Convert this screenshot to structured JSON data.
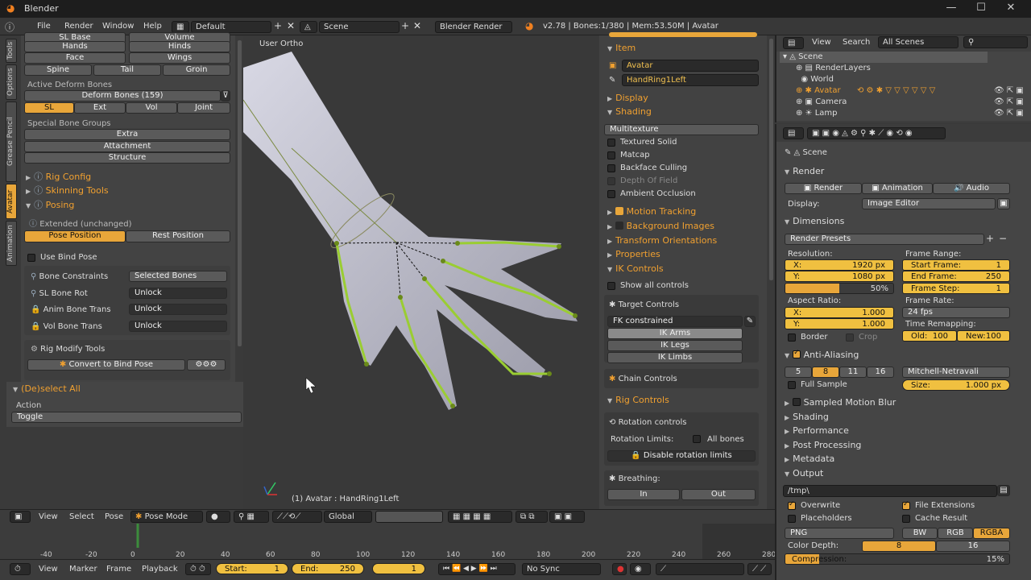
{
  "window": {
    "title": "Blender",
    "controls": [
      "—",
      "☐",
      "✕"
    ]
  },
  "menubar": {
    "items": [
      "File",
      "Render",
      "Window",
      "Help"
    ],
    "layout": "Default",
    "scene": "Scene",
    "engine": "Blender Render",
    "stats": "v2.78 | Bones:1/380 | Mem:53.50M | Avatar"
  },
  "tools_tabs": [
    "Tools",
    "Options",
    "Grease Pencil",
    "Avatar",
    "Animation"
  ],
  "left": {
    "bone_groups_top": [
      "SL Base",
      "Volume",
      "Hands",
      "Hinds",
      "Face",
      "Wings"
    ],
    "bone_groups_row3": [
      "Spine",
      "Tail",
      "Groin"
    ],
    "active_deform_label": "Active Deform Bones",
    "deform_bones": "Deform Bones (159)",
    "deform_tabs": [
      "SL",
      "Ext",
      "Vol",
      "Joint"
    ],
    "special_groups_label": "Special Bone Groups",
    "special_groups": [
      "Extra",
      "Attachment",
      "Structure"
    ],
    "rig_config": "Rig Config",
    "skinning_tools": "Skinning Tools",
    "posing": "Posing",
    "extended": "Extended (unchanged)",
    "pose_position": "Pose Position",
    "rest_position": "Rest Position",
    "use_bind_pose": "Use Bind Pose",
    "bone_constraints_label": "Bone Constraints",
    "bone_constraints_value": "Selected Bones",
    "sl_bone_rot": "SL Bone Rot",
    "anim_bone_trans": "Anim Bone Trans",
    "vol_bone_trans": "Vol Bone Trans",
    "unlock": "Unlock",
    "rig_modify_tools": "Rig Modify Tools",
    "convert_bind_pose": "Convert to Bind Pose",
    "operator_title": "(De)select All",
    "action_label": "Action",
    "action_value": "Toggle"
  },
  "viewport": {
    "view_label": "User Ortho",
    "status": "(1) Avatar : HandRing1Left"
  },
  "nprops": {
    "item_header": "Item",
    "object_name": "Avatar",
    "bone_name": "HandRing1Left",
    "display": "Display",
    "shading": "Shading",
    "shading_mode": "Multitexture",
    "textured_solid": "Textured Solid",
    "matcap": "Matcap",
    "backface_culling": "Backface Culling",
    "depth_of_field": "Depth Of Field",
    "ambient_occlusion": "Ambient Occlusion",
    "motion_tracking": "Motion Tracking",
    "background_images": "Background Images",
    "transform_orientations": "Transform Orientations",
    "properties": "Properties",
    "ik_controls": "IK Controls",
    "show_all_controls": "Show all controls",
    "target_controls": "Target Controls",
    "fk_constrained": "FK constrained",
    "ik_list": [
      "IK Arms",
      "IK Legs",
      "IK Limbs"
    ],
    "chain_controls": "Chain Controls",
    "rig_controls": "Rig Controls",
    "rotation_controls": "Rotation controls",
    "rotation_limits": "Rotation Limits:",
    "all_bones": "All bones",
    "disable_rotation_limits": "Disable rotation limits",
    "breathing": "Breathing:",
    "in": "In",
    "out": "Out"
  },
  "view3d_header": {
    "items": [
      "View",
      "Select",
      "Pose"
    ],
    "mode": "Pose Mode",
    "orientation": "Global"
  },
  "timeline": {
    "ticks": [
      "-40",
      "-20",
      "0",
      "20",
      "40",
      "60",
      "80",
      "100",
      "120",
      "140",
      "160",
      "180",
      "200",
      "220",
      "240",
      "260",
      "280"
    ],
    "menu": [
      "View",
      "Marker",
      "Frame",
      "Playback"
    ],
    "start_label": "Start:",
    "start": "1",
    "end_label": "End:",
    "end": "250",
    "current": "1",
    "sync": "No Sync"
  },
  "outliner": {
    "menu": [
      "View",
      "Search"
    ],
    "filter": "All Scenes",
    "items": [
      "Scene",
      "RenderLayers",
      "World",
      "Avatar",
      "Camera",
      "Lamp"
    ]
  },
  "properties": {
    "breadcrumb": "Scene",
    "render_header": "Render",
    "render_btn": "Render",
    "animation_btn": "Animation",
    "audio_btn": "Audio",
    "display_label": "Display:",
    "display_value": "Image Editor",
    "dimensions": "Dimensions",
    "render_presets": "Render Presets",
    "resolution": "Resolution:",
    "res_x_label": "X:",
    "res_x": "1920 px",
    "res_y_label": "Y:",
    "res_y": "1080 px",
    "res_pct": "50%",
    "res_pct_value": 0.5,
    "frame_range": "Frame Range:",
    "start_frame_label": "Start Frame:",
    "start_frame": "1",
    "end_frame_label": "End Frame:",
    "end_frame": "250",
    "frame_step_label": "Frame Step:",
    "frame_step": "1",
    "aspect_ratio": "Aspect Ratio:",
    "asp_x": "1.000",
    "asp_y": "1.000",
    "frame_rate": "Frame Rate:",
    "fps": "24 fps",
    "border": "Border",
    "crop": "Crop",
    "time_remapping": "Time Remapping:",
    "old_label": "Old:",
    "old": "100",
    "new_label": "New:",
    "new": "100",
    "anti_aliasing": "Anti-Aliasing",
    "aa_samples": [
      "5",
      "8",
      "11",
      "16"
    ],
    "aa_filter": "Mitchell-Netravali",
    "full_sample": "Full Sample",
    "size_label": "Size:",
    "size": "1.000 px",
    "sampled_motion_blur": "Sampled Motion Blur",
    "shading": "Shading",
    "performance": "Performance",
    "post_processing": "Post Processing",
    "metadata": "Metadata",
    "output": "Output",
    "path": "/tmp\\",
    "overwrite": "Overwrite",
    "file_extensions": "File Extensions",
    "placeholders": "Placeholders",
    "cache_result": "Cache Result",
    "format": "PNG",
    "bw": "BW",
    "rgb": "RGB",
    "rgba": "RGBA",
    "color_depth": "Color Depth:",
    "depth_8": "8",
    "depth_16": "16",
    "compression_label": "Compression:",
    "compression": "15%",
    "compression_value": 0.15
  },
  "colors": {
    "accent": "#f0a030",
    "bone": "#9acd32",
    "bg": "#3a3a3a"
  }
}
